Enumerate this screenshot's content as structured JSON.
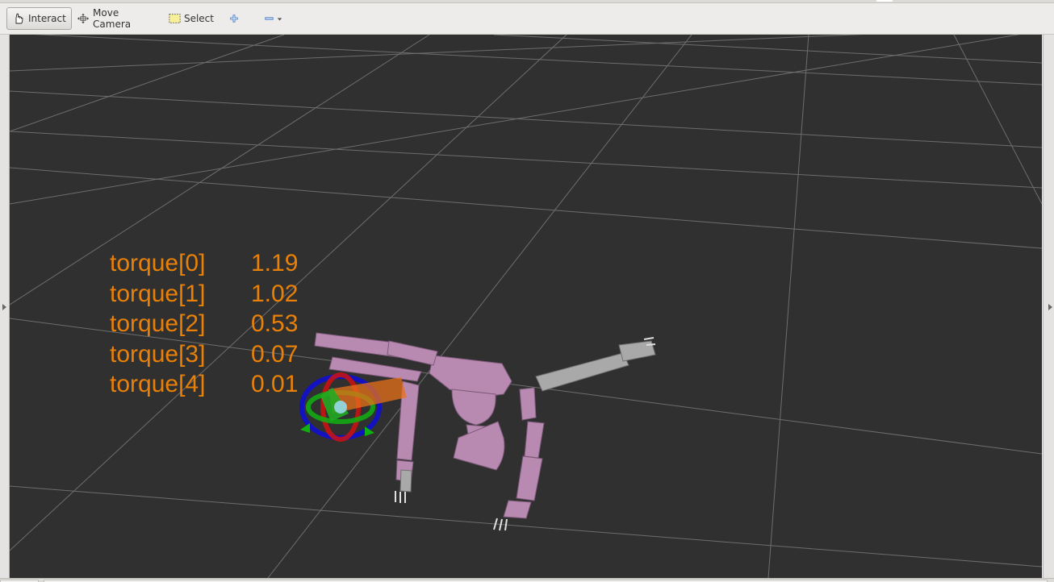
{
  "toolbar": {
    "tools": [
      {
        "id": "interact",
        "label": "Interact",
        "icon": "hand-pointer-icon",
        "active": true
      },
      {
        "id": "move-camera",
        "label": "Move Camera",
        "icon": "move-camera-icon",
        "active": false
      },
      {
        "id": "select",
        "label": "Select",
        "icon": "select-rectangle-icon",
        "active": false
      }
    ],
    "add_tool_icon": "plus-icon",
    "remove_tool_icon": "minus-icon",
    "dropdown_icon": "chevron-down-icon"
  },
  "overlay": {
    "color": "#e98108",
    "rows": [
      {
        "label": "torque[0]",
        "value": "1.19"
      },
      {
        "label": "torque[1]",
        "value": "1.02"
      },
      {
        "label": "torque[2]",
        "value": "0.53"
      },
      {
        "label": "torque[3]",
        "value": "0.07"
      },
      {
        "label": "torque[4]",
        "value": "0.01"
      }
    ]
  },
  "scene": {
    "background": "#303030",
    "grid_color": "#a0a0a0",
    "robot_color": "#b88ab2",
    "arm_color": "#a9a9a9",
    "marker_colors": {
      "x": "#d01010",
      "y": "#10b010",
      "z": "#1010d0",
      "torque": "#e87018"
    }
  }
}
